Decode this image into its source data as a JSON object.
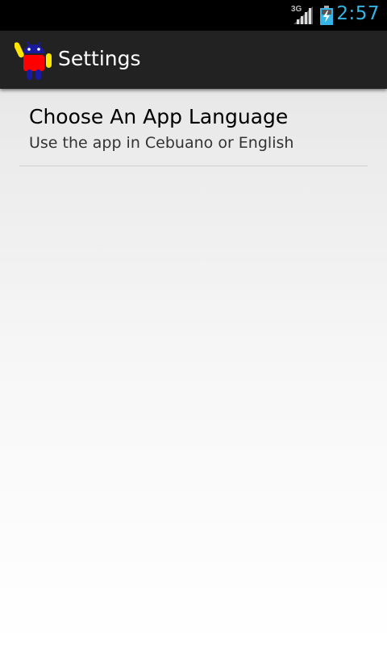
{
  "status_bar": {
    "network_type": "3G",
    "signal_icon": "signal-icon",
    "battery_icon": "battery-charging-icon",
    "time": "2:57",
    "accent_color": "#33b5e5"
  },
  "action_bar": {
    "app_icon": "android-app-icon",
    "title": "Settings"
  },
  "preferences": [
    {
      "title": "Choose An App Language",
      "summary": "Use the app in Cebuano or English"
    }
  ]
}
